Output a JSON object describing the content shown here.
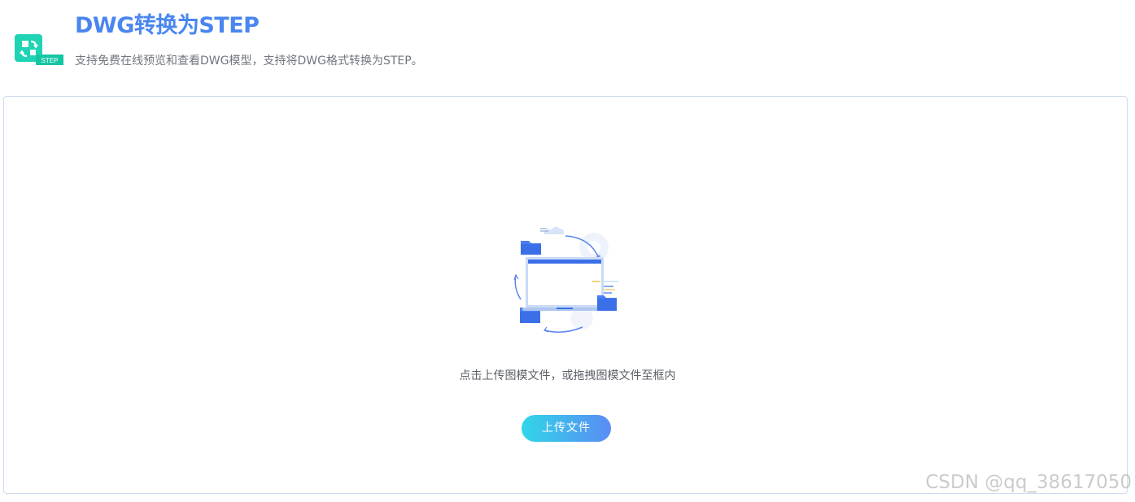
{
  "header": {
    "title": "DWG转换为STEP",
    "subtitle": "支持免费在线预览和查看DWG模型，支持将DWG格式转换为STEP。",
    "logo_badge": "STEP",
    "logo_icon": "convert-arrows-icon"
  },
  "upload": {
    "illustration_icon": "upload-folders-illustration",
    "hint": "点击上传图模文件，或拖拽图模文件至框内",
    "button_label": "上传文件"
  },
  "watermark": "CSDN @qq_38617050",
  "colors": {
    "accent": "#4a86f0",
    "logo_teal": "#1fd3b4",
    "button_gradient_start": "#30d6e8",
    "button_gradient_end": "#5a8cf4",
    "border": "#cfdcef"
  }
}
